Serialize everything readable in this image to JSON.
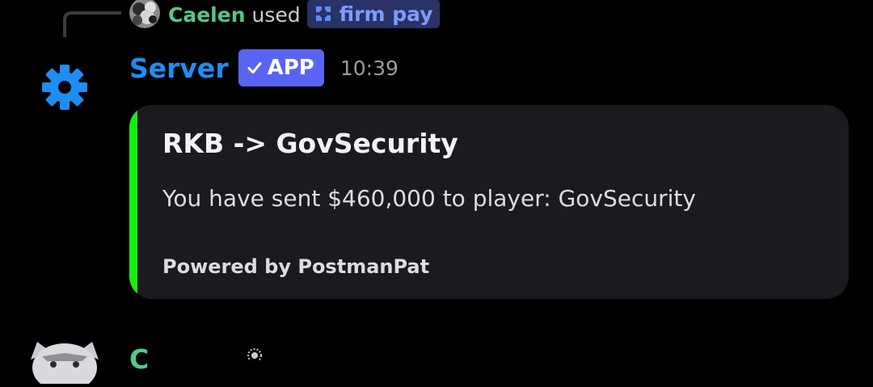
{
  "reply": {
    "user_name": "Caelen",
    "verb": "used",
    "command_name": "firm pay",
    "colors": {
      "user_name": "#57c785",
      "command_chip_bg": "#2a3266",
      "command_chip_text": "#7f9bff"
    }
  },
  "message": {
    "author": "Server",
    "badge": "APP",
    "timestamp": "10:39",
    "avatar_icon": "gear-icon",
    "colors": {
      "author": "#1e8ef2",
      "badge_bg": "#5865f2"
    }
  },
  "embed": {
    "title": "RKB -> GovSecurity",
    "description": "You have sent $460,000 to player: GovSecurity",
    "footer": "Powered by PostmanPat",
    "accent_color": "#15f00f"
  },
  "next_message": {
    "author_partial": "C",
    "avatar_icon": "wolf-avatar"
  }
}
